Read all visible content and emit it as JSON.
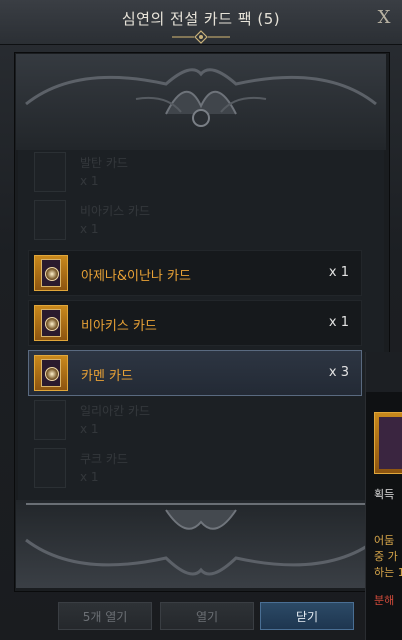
{
  "window": {
    "title": "심연의 전설 카드 팩 (5)",
    "close_symbol": "X"
  },
  "ghost_items": [
    {
      "name": "발탄 카드",
      "count": "x 1"
    },
    {
      "name": "비아키스 카드",
      "count": "x 1"
    },
    {
      "name": "일리아칸 카드",
      "count": "x 1"
    },
    {
      "name": "쿠크 카드",
      "count": "x 1"
    }
  ],
  "cards": [
    {
      "name": "아제나&이난나 카드",
      "count": "x 1",
      "selected": false,
      "icon": "legendary-card-icon"
    },
    {
      "name": "비아키스 카드",
      "count": "x 1",
      "selected": false,
      "icon": "legendary-card-icon"
    },
    {
      "name": "카멘 카드",
      "count": "x 3",
      "selected": true,
      "icon": "legendary-card-icon"
    }
  ],
  "side_panel": {
    "text_1": "획득 ",
    "text_2": "어둠",
    "text_3": "중 가",
    "text_4": "하는 1",
    "text_5": "분해"
  },
  "buttons": {
    "open_five": "5개 열기",
    "open": "열기",
    "close": "닫기"
  },
  "colors": {
    "card_name": "#e9a236",
    "accent_blue": "#4a6f94",
    "warning_red": "#d04a3a"
  }
}
